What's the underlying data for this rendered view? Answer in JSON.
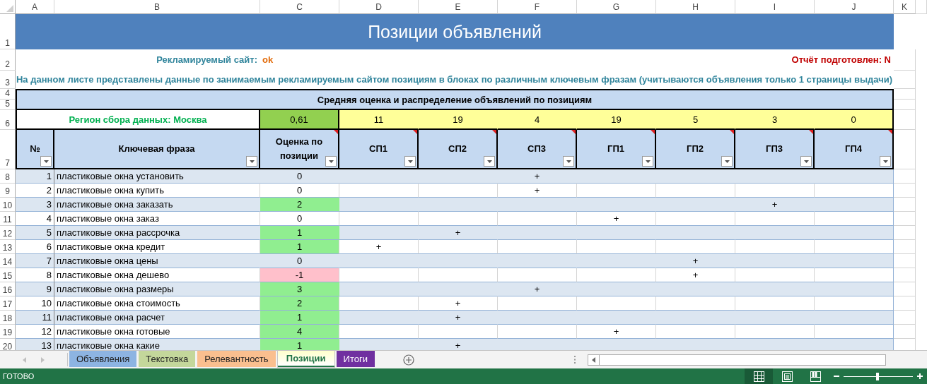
{
  "column_headers": [
    "A",
    "B",
    "C",
    "D",
    "E",
    "F",
    "G",
    "H",
    "I",
    "J",
    "K"
  ],
  "row_headers": [
    "1",
    "2",
    "3",
    "4",
    "5",
    "6",
    "7",
    "8",
    "9",
    "10",
    "11",
    "12",
    "13",
    "14",
    "15",
    "16",
    "17",
    "18",
    "19",
    "20"
  ],
  "title": "Позиции объявлений",
  "site": {
    "label": "Рекламируемый сайт:",
    "value": "ok"
  },
  "report": "Отчёт подготовлен: N",
  "description": "На данном листе представлены данные по занимаемым рекламируемым сайтом позициям в блоках по различным ключевым фразам (учитываются объявления только 1 страницы выдачи)",
  "summary": {
    "heading": "Средняя оценка и распределение объявлений по позициям",
    "region": "Регион сбора данных: Москва",
    "average": "0,61",
    "counts": [
      "11",
      "19",
      "4",
      "19",
      "5",
      "3",
      "0"
    ]
  },
  "table": {
    "columns": [
      {
        "label": "№",
        "has_comment": false
      },
      {
        "label": "Ключевая фраза",
        "has_comment": false
      },
      {
        "label": "Оценка по позиции",
        "has_comment": true
      },
      {
        "label": "СП1",
        "has_comment": true
      },
      {
        "label": "СП2",
        "has_comment": true
      },
      {
        "label": "СП3",
        "has_comment": true
      },
      {
        "label": "ГП1",
        "has_comment": true
      },
      {
        "label": "ГП2",
        "has_comment": true
      },
      {
        "label": "ГП3",
        "has_comment": true
      },
      {
        "label": "ГП4",
        "has_comment": true
      }
    ],
    "rows": [
      {
        "number": "1",
        "phrase": "пластиковые окна установить",
        "score": "0",
        "mark": "+",
        "marked": [
          false,
          false,
          true,
          false,
          false,
          false,
          false
        ]
      },
      {
        "number": "2",
        "phrase": "пластиковые окна купить",
        "score": "0",
        "mark": "+",
        "marked": [
          false,
          false,
          true,
          false,
          false,
          false,
          false
        ]
      },
      {
        "number": "3",
        "phrase": "пластиковые окна заказать",
        "score": "2",
        "color": "#90ee90",
        "mark": "+",
        "marked": [
          false,
          false,
          false,
          false,
          false,
          true,
          false
        ]
      },
      {
        "number": "4",
        "phrase": "пластиковые окна заказ",
        "score": "0",
        "mark": "+",
        "marked": [
          false,
          false,
          false,
          true,
          false,
          false,
          false
        ]
      },
      {
        "number": "5",
        "phrase": "пластиковые окна рассрочка",
        "score": "1",
        "color": "#90ee90",
        "mark": "+",
        "marked": [
          false,
          true,
          false,
          false,
          false,
          false,
          false
        ]
      },
      {
        "number": "6",
        "phrase": "пластиковые окна кредит",
        "score": "1",
        "color": "#90ee90",
        "mark": "+",
        "marked": [
          true,
          false,
          false,
          false,
          false,
          false,
          false
        ]
      },
      {
        "number": "7",
        "phrase": "пластиковые окна цены",
        "score": "0",
        "mark": "+",
        "marked": [
          false,
          false,
          false,
          false,
          true,
          false,
          false
        ]
      },
      {
        "number": "8",
        "phrase": "пластиковые окна дешево",
        "score": "-1",
        "color": "#ffc0cb",
        "mark": "+",
        "marked": [
          false,
          false,
          false,
          false,
          true,
          false,
          false
        ]
      },
      {
        "number": "9",
        "phrase": "пластиковые окна размеры",
        "score": "3",
        "color": "#90ee90",
        "mark": "+",
        "marked": [
          false,
          false,
          true,
          false,
          false,
          false,
          false
        ]
      },
      {
        "number": "10",
        "phrase": "пластиковые окна стоимость",
        "score": "2",
        "color": "#90ee90",
        "mark": "+",
        "marked": [
          false,
          true,
          false,
          false,
          false,
          false,
          false
        ]
      },
      {
        "number": "11",
        "phrase": "пластиковые окна расчет",
        "score": "1",
        "color": "#90ee90",
        "mark": "+",
        "marked": [
          false,
          true,
          false,
          false,
          false,
          false,
          false
        ]
      },
      {
        "number": "12",
        "phrase": "пластиковые окна готовые",
        "score": "4",
        "color": "#90ee90",
        "mark": "+",
        "marked": [
          false,
          false,
          false,
          true,
          false,
          false,
          false
        ]
      },
      {
        "number": "13",
        "phrase": "пластиковые окна какие",
        "score": "1",
        "color": "#90ee90",
        "mark": "+",
        "marked": [
          false,
          true,
          false,
          false,
          false,
          false,
          false
        ]
      }
    ]
  },
  "sheet_tabs": [
    {
      "label": "Объявления",
      "color": "#8db4e2",
      "selected": false
    },
    {
      "label": "Текстовка",
      "color": "#c4d79b",
      "selected": false
    },
    {
      "label": "Релевантность",
      "color": "#fabf8f",
      "selected": false
    },
    {
      "label": "Позиции",
      "color": "#ffffcc",
      "selected": true
    },
    {
      "label": "Итоги",
      "color": "#7030a0",
      "selected": false
    }
  ],
  "status": {
    "text": "ГОТОВО",
    "views": [
      {
        "kind": "normal",
        "selected": true
      },
      {
        "kind": "page-layout",
        "selected": false
      },
      {
        "kind": "page-break",
        "selected": false
      }
    ]
  },
  "zoom": {
    "level": 0.49
  }
}
